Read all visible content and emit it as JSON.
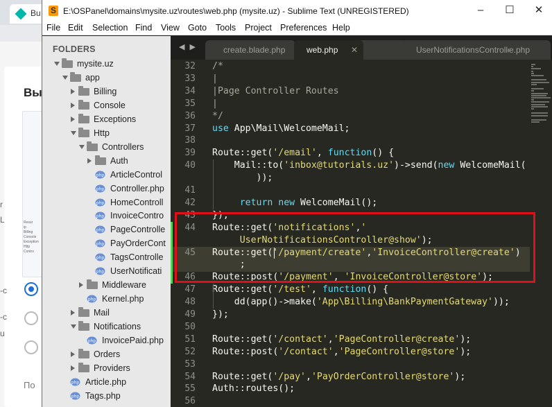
{
  "background_window": {
    "tab_label": "Bu",
    "heading": "Вы",
    "side_letters": [
      "r",
      "L",
      "-c",
      "-c",
      "u"
    ],
    "mini_preview_lines": [
      "Resur",
      "ip",
      "Billing",
      "Console",
      "Exception",
      "Http",
      "Contro"
    ],
    "bottom_label": "По"
  },
  "window": {
    "title": "E:\\OSPanel\\domains\\mysite.uz\\routes\\web.php (mysite.uz) - Sublime Text (UNREGISTERED)",
    "app_icon": "sublime-text-icon",
    "controls": {
      "minimize": "–",
      "maximize": "☐",
      "close": "✕"
    }
  },
  "menu": [
    "File",
    "Edit",
    "Selection",
    "Find",
    "View",
    "Goto",
    "Tools",
    "Project",
    "Preferences",
    "Help"
  ],
  "sidebar": {
    "header": "FOLDERS",
    "nodes": [
      {
        "label": "mysite.uz",
        "type": "folder",
        "state": "open"
      },
      {
        "label": "app",
        "type": "folder",
        "state": "open"
      },
      {
        "label": "Billing",
        "type": "folder",
        "state": "closed"
      },
      {
        "label": "Console",
        "type": "folder",
        "state": "closed"
      },
      {
        "label": "Exceptions",
        "type": "folder",
        "state": "closed"
      },
      {
        "label": "Http",
        "type": "folder",
        "state": "open"
      },
      {
        "label": "Controllers",
        "type": "folder",
        "state": "open"
      },
      {
        "label": "Auth",
        "type": "folder",
        "state": "closed"
      },
      {
        "label": "ArticleControl",
        "type": "file"
      },
      {
        "label": "Controller.php",
        "type": "file"
      },
      {
        "label": "HomeControll",
        "type": "file"
      },
      {
        "label": "InvoiceContro",
        "type": "file"
      },
      {
        "label": "PageControlle",
        "type": "file"
      },
      {
        "label": "PayOrderCont",
        "type": "file"
      },
      {
        "label": "TagsControlle",
        "type": "file"
      },
      {
        "label": "UserNotificati",
        "type": "file"
      },
      {
        "label": "Middleware",
        "type": "folder",
        "state": "closed"
      },
      {
        "label": "Kernel.php",
        "type": "file"
      },
      {
        "label": "Mail",
        "type": "folder",
        "state": "closed"
      },
      {
        "label": "Notifications",
        "type": "folder",
        "state": "open"
      },
      {
        "label": "InvoicePaid.php",
        "type": "file"
      },
      {
        "label": "Orders",
        "type": "folder",
        "state": "closed"
      },
      {
        "label": "Providers",
        "type": "folder",
        "state": "closed"
      },
      {
        "label": "Article.php",
        "type": "file"
      },
      {
        "label": "Tags.php",
        "type": "file"
      }
    ]
  },
  "tabs": {
    "nav": "◀ ▶",
    "items": [
      {
        "label": "create.blade.php",
        "active": false
      },
      {
        "label": "web.php",
        "active": true,
        "close": "✕"
      },
      {
        "label": "UserNotificationsController.php",
        "active": false,
        "close": "✕"
      },
      {
        "label": "e.php",
        "active": false
      }
    ]
  },
  "editor": {
    "line_numbers": [
      "32",
      "33",
      "34",
      "35",
      "36",
      "37",
      "38",
      "39",
      "40",
      "",
      "41",
      "42",
      "43",
      "44",
      "",
      "45",
      "",
      "46",
      "47",
      "48",
      "49",
      "50",
      "51",
      "52",
      "53",
      "54",
      "55",
      "56"
    ],
    "lines": [
      [
        [
          "/*",
          "cm"
        ]
      ],
      [
        [
          "|",
          "cm"
        ]
      ],
      [
        [
          "|Page Controller Routes",
          "cm"
        ]
      ],
      [
        [
          "|",
          "cm"
        ]
      ],
      [
        [
          "*/",
          "cm"
        ]
      ],
      [
        [
          "use ",
          "kw"
        ],
        [
          "App\\Mail\\WelcomeMail;",
          "fn"
        ]
      ],
      [],
      [
        [
          "Route::get(",
          "fn"
        ],
        [
          "'/email'",
          "str"
        ],
        [
          ", ",
          "fn"
        ],
        [
          "function",
          "kw"
        ],
        [
          "() {",
          "fn"
        ]
      ],
      [
        [
          "    Mail::to(",
          "fn"
        ],
        [
          "'inbox@tutorials.uz'",
          "str"
        ],
        [
          ")->send(",
          "fn"
        ],
        [
          "new ",
          "kw"
        ],
        [
          "WelcomeMail(",
          "fn"
        ]
      ],
      [
        [
          "        ));",
          "fn"
        ]
      ],
      [],
      [
        [
          "     return ",
          "kw"
        ],
        [
          "new ",
          "kw"
        ],
        [
          "WelcomeMail();",
          "fn"
        ]
      ],
      [
        [
          "});",
          "fn"
        ]
      ],
      [
        [
          "Route::get(",
          "fn"
        ],
        [
          "'notifications'",
          "str"
        ],
        [
          ",",
          "fn"
        ],
        [
          "'",
          "str"
        ]
      ],
      [
        [
          "     UserNotificationsController@show'",
          "str"
        ],
        [
          ");",
          "fn"
        ]
      ],
      [
        [
          "Route::get(",
          "fn"
        ],
        [
          "'/payment/create'",
          "str"
        ],
        [
          ",",
          "fn"
        ],
        [
          "'InvoiceController@create'",
          "str"
        ],
        [
          ")",
          "fn"
        ]
      ],
      [
        [
          "     ;",
          "fn"
        ]
      ],
      [
        [
          "Route::post(",
          "fn"
        ],
        [
          "'/payment'",
          "str"
        ],
        [
          ", ",
          "fn"
        ],
        [
          "'InvoiceController@store'",
          "str"
        ],
        [
          ");",
          "fn"
        ]
      ],
      [
        [
          "Route::get(",
          "fn"
        ],
        [
          "'/test'",
          "str"
        ],
        [
          ", ",
          "fn"
        ],
        [
          "function",
          "kw"
        ],
        [
          "() {",
          "fn"
        ]
      ],
      [
        [
          "    dd(app()->make(",
          "fn"
        ],
        [
          "'App\\Billing\\BankPaymentGateway'",
          "str"
        ],
        [
          "));",
          "fn"
        ]
      ],
      [
        [
          "});",
          "fn"
        ]
      ],
      [],
      [
        [
          "Route::get(",
          "fn"
        ],
        [
          "'/contact'",
          "str"
        ],
        [
          ",",
          "fn"
        ],
        [
          "'PageController@create'",
          "str"
        ],
        [
          ");",
          "fn"
        ]
      ],
      [
        [
          "Route::post(",
          "fn"
        ],
        [
          "'/contact'",
          "str"
        ],
        [
          ",",
          "fn"
        ],
        [
          "'PageController@store'",
          "str"
        ],
        [
          ");",
          "fn"
        ]
      ],
      [],
      [
        [
          "Route::get(",
          "fn"
        ],
        [
          "'/pay'",
          "str"
        ],
        [
          ",",
          "fn"
        ],
        [
          "'PayOrderController@store'",
          "str"
        ],
        [
          ");",
          "fn"
        ]
      ],
      [
        [
          "Auth::routes();",
          "fn"
        ]
      ],
      []
    ]
  },
  "colors": {
    "editor_bg": "#272822",
    "comment": "#a8a89c",
    "keyword": "#66d9ef",
    "string": "#e6db74",
    "highlight_box": "#e0101a",
    "diff_marker": "#57d15e"
  }
}
